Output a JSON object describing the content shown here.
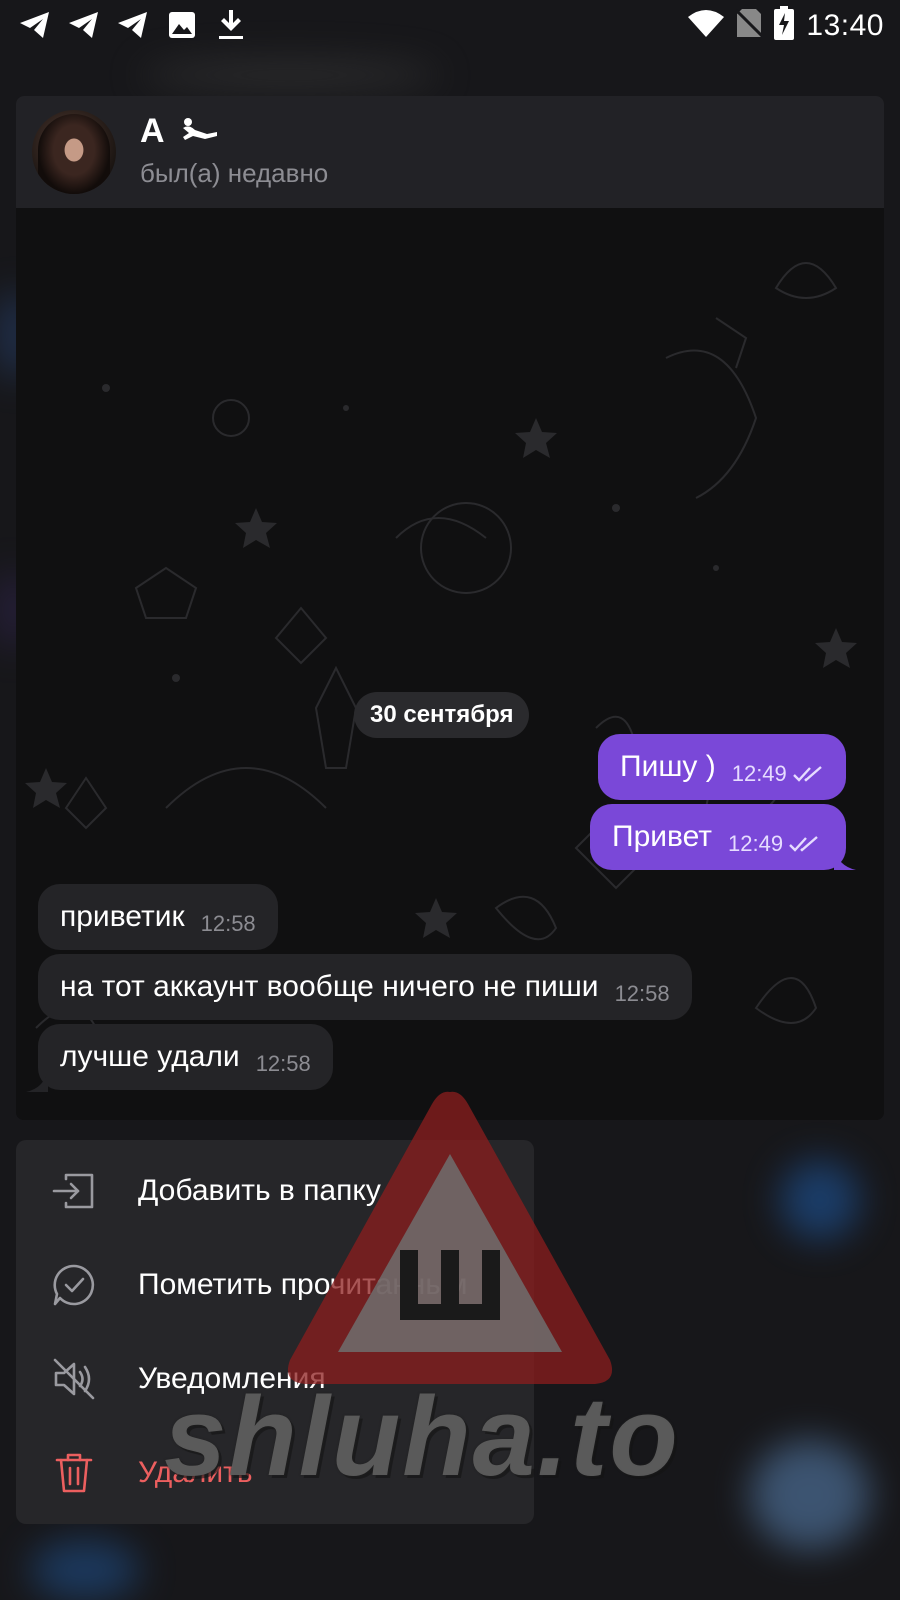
{
  "status_bar": {
    "time": "13:40",
    "left_icons": [
      "telegram-icon",
      "telegram-icon",
      "telegram-icon",
      "image-icon",
      "download-icon"
    ],
    "right_icons": [
      "wifi-icon",
      "no-sim-icon",
      "battery-charging-icon"
    ]
  },
  "chat": {
    "name": "A",
    "status": "был(а) недавно",
    "date_divider": "30 сентября",
    "messages": [
      {
        "direction": "out",
        "text": "Пишу )",
        "time": "12:49",
        "read": true
      },
      {
        "direction": "out",
        "text": "Привет",
        "time": "12:49",
        "read": true
      },
      {
        "direction": "in",
        "text": "приветик",
        "time": "12:58"
      },
      {
        "direction": "in",
        "text": "на тот аккаунт вообще ничего не пиши",
        "time": "12:58"
      },
      {
        "direction": "in",
        "text": "лучше удали",
        "time": "12:58"
      }
    ]
  },
  "context_menu": {
    "items": [
      {
        "label": "Добавить в папку",
        "icon": "folder-add-icon"
      },
      {
        "label": "Пометить прочитанным",
        "icon": "mark-read-icon"
      },
      {
        "label": "Уведомления",
        "icon": "mute-icon"
      },
      {
        "label": "Удалить",
        "icon": "trash-icon",
        "danger": true
      }
    ]
  },
  "watermark": {
    "text": "shluha.to",
    "logo_letter": "Ш"
  },
  "colors": {
    "outgoing_bubble": "#7a48d8",
    "incoming_bubble": "#242427",
    "danger": "#ec5f5f",
    "header": "#222226"
  }
}
